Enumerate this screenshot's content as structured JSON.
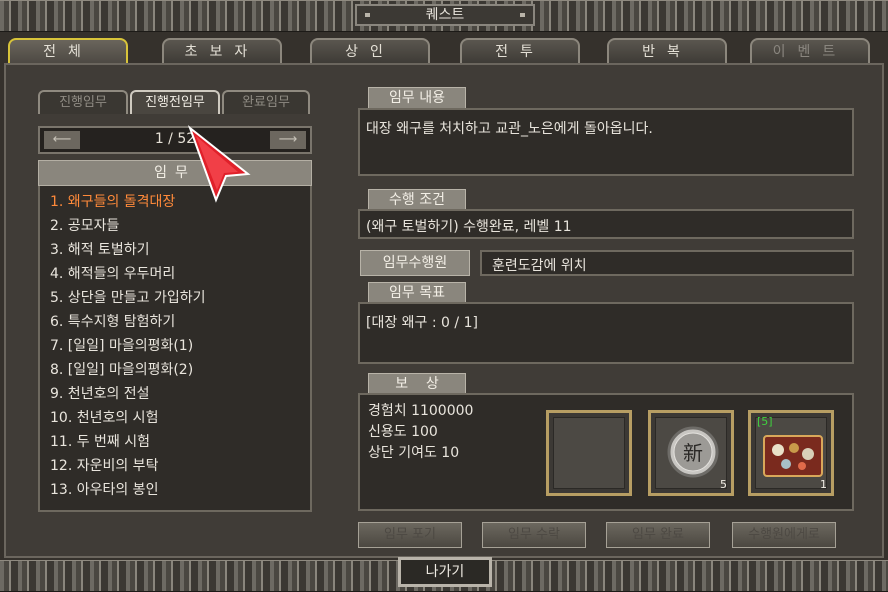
{
  "window": {
    "title": "퀘스트"
  },
  "tabs": [
    {
      "label": "전체",
      "active": true
    },
    {
      "label": "초보자"
    },
    {
      "label": "상인"
    },
    {
      "label": "전투"
    },
    {
      "label": "반복"
    },
    {
      "label": "이벤트",
      "dim": true
    }
  ],
  "subtabs": [
    {
      "label": "진행임무"
    },
    {
      "label": "진행전임무",
      "active": true
    },
    {
      "label": "완료임무"
    }
  ],
  "pager": {
    "label": "1 / 52",
    "prev_icon": "left-arrow-icon",
    "next_icon": "right-arrow-icon"
  },
  "list": {
    "header": "임무",
    "items": [
      "1. 왜구들의 돌격대장",
      "2. 공모자들",
      "3. 해적 토벌하기",
      "4. 해적들의 우두머리",
      "5. 상단을 만들고 가입하기",
      "6. 특수지형 탐험하기",
      "7. [일일] 마을의평화(1)",
      "8. [일일] 마을의평화(2)",
      "9. 천년호의 전설",
      "10. 천년호의 시험",
      "11. 두 번째 시험",
      "12. 자운비의 부탁",
      "13. 아우타의 봉인"
    ],
    "selected_index": 0
  },
  "detail": {
    "content_header": "임무 내용",
    "content_text": "대장 왜구를 처치하고 교관_노은에게 돌아옵니다.",
    "condition_header": "수행 조건",
    "condition_text": "(왜구 토벌하기) 수행완료, 레벨 11",
    "agent_button": "임무수행원",
    "agent_text": "훈련도감에 위치",
    "goal_header": "임무 목표",
    "goal_text": "[대장 왜구 : 0 / 1]",
    "reward_header": "보    상",
    "reward_lines": [
      "경험치 1100000",
      "신용도 100",
      "상단 기여도 10"
    ],
    "reward_slots": [
      {
        "icon": "empty-slot",
        "qty": ""
      },
      {
        "icon": "new-coin-icon",
        "glyph": "新",
        "qty": "5"
      },
      {
        "icon": "treasure-box-icon",
        "badge": "[5]",
        "qty": "1"
      }
    ]
  },
  "actions": [
    "임무 포기",
    "임무 수락",
    "임무 완료",
    "수행원에게로"
  ],
  "exit_label": "나가기",
  "colors": {
    "selected_item": "#ff8a3a",
    "active_tab_border": "#d8c43a",
    "cursor": "#e0202a"
  }
}
